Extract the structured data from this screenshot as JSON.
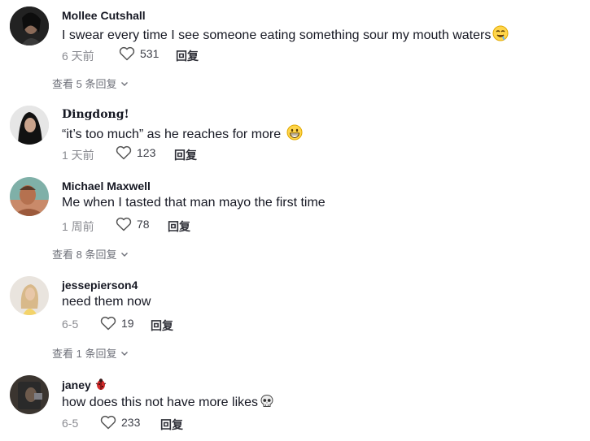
{
  "comments": [
    {
      "username": "Mollee Cutshall",
      "text": "I swear every time I see someone eating something sour my mouth waters",
      "emoji": "drooling-face",
      "time": "6 天前",
      "likes": "531",
      "reply_label": "回复",
      "view_replies": "查看 5 条回复"
    },
    {
      "username": "Dingdong!",
      "text": "“it’s too much” as he reaches for more",
      "emoji": "grinning-face",
      "time": "1 天前",
      "likes": "123",
      "reply_label": "回复"
    },
    {
      "username": "Michael Maxwell",
      "text": "Me when I tasted that man mayo the first time",
      "time": "1 周前",
      "likes": "78",
      "reply_label": "回复",
      "view_replies": "查看 8 条回复"
    },
    {
      "username": "jessepierson4",
      "text": "need them now",
      "time": "6-5",
      "likes": "19",
      "reply_label": "回复",
      "view_replies": "查看 1 条回复"
    },
    {
      "username": "janey",
      "username_badge": "beetle",
      "text": "how does this not have more likes",
      "emoji": "skull",
      "time": "6-5",
      "likes": "233",
      "reply_label": "回复"
    }
  ],
  "icons": {
    "like": "heart-outline-icon",
    "expand": "chevron-down-icon"
  },
  "colors": {
    "text": "#161823",
    "muted": "#8a8b91",
    "reply": "#2f3038"
  }
}
